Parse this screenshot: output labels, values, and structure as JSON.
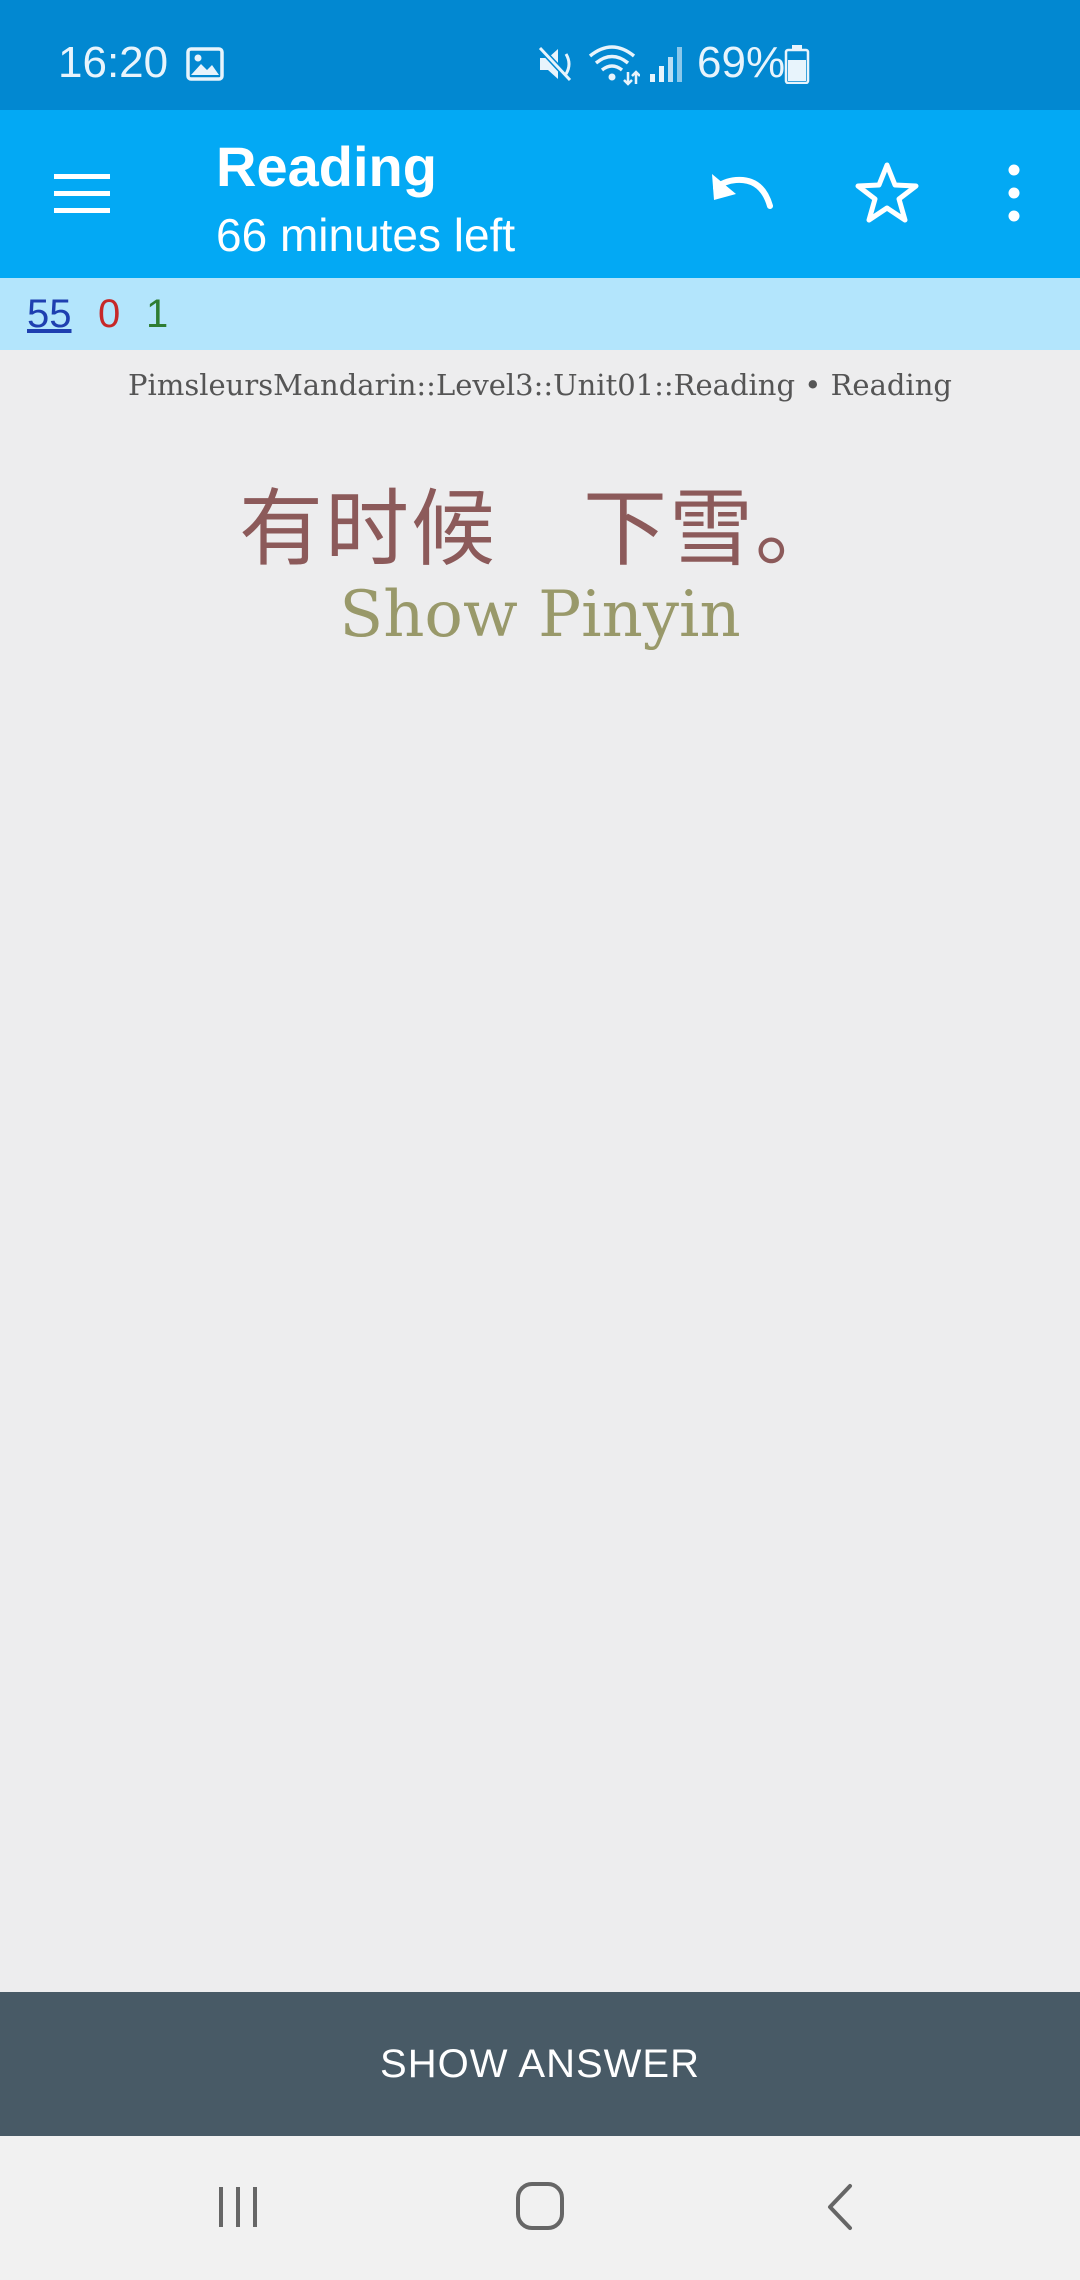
{
  "status_bar": {
    "time": "16:20",
    "battery_percent": "69%",
    "icons": [
      "image-icon",
      "mute-icon",
      "wifi-icon",
      "signal-icon",
      "battery-icon"
    ]
  },
  "app_bar": {
    "title": "Reading",
    "subtitle": "66 minutes left",
    "icons": [
      "menu-icon",
      "undo-icon",
      "star-icon",
      "more-vert-icon"
    ]
  },
  "counts": {
    "new": "55",
    "learning": "0",
    "review": "1",
    "colors": {
      "new": "#1e3fb0",
      "learning": "#c62828",
      "review": "#2e7d32"
    }
  },
  "card": {
    "deck_path": "PimsleursMandarin::Level3::Unit01::Reading • Reading",
    "front_text": "有时候   下雪。",
    "pinyin_toggle": "Show Pinyin"
  },
  "answer_button": {
    "label": "SHOW ANSWER"
  },
  "nav_bar": {
    "icons": [
      "recents-icon",
      "home-icon",
      "back-icon"
    ]
  },
  "colors": {
    "status_bar": "#0288d1",
    "app_bar": "#03a9f4",
    "counts_bar": "#b3e5fc",
    "background": "#ededee",
    "answer_button": "#485a66"
  }
}
